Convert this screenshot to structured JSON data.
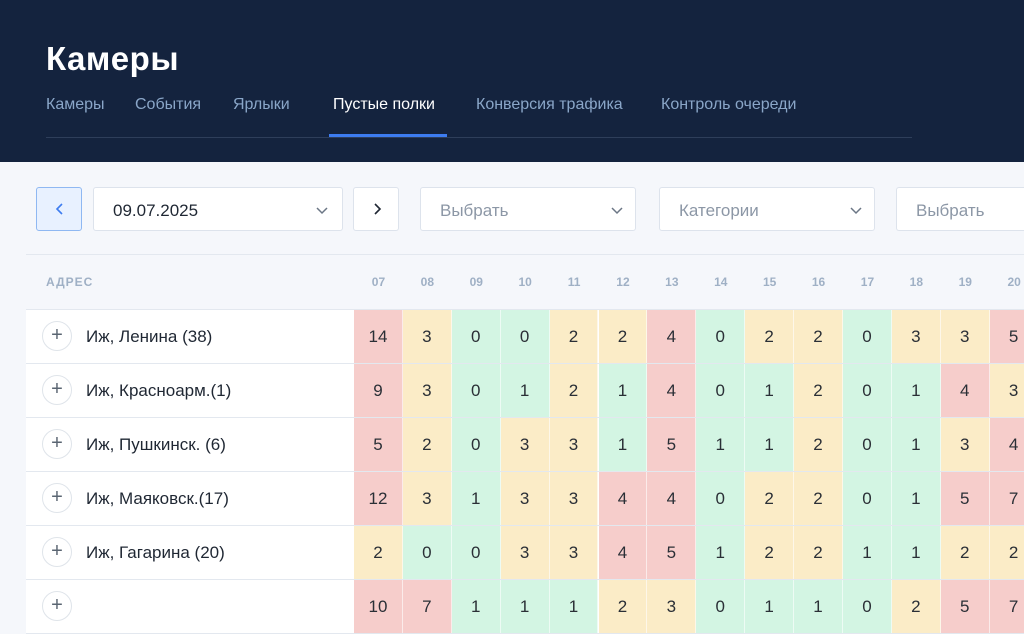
{
  "header": {
    "title": "Камеры",
    "tabs": [
      {
        "label": "Камеры",
        "active": false
      },
      {
        "label": "События",
        "active": false
      },
      {
        "label": "Ярлыки",
        "active": false
      },
      {
        "label": "Пустые полки",
        "active": true
      },
      {
        "label": "Конверсия трафика",
        "active": false
      },
      {
        "label": "Контроль очереди",
        "active": false
      }
    ]
  },
  "filters": {
    "date": "09.07.2025",
    "select1_placeholder": "Выбрать",
    "categories_placeholder": "Категории",
    "select2_placeholder": "Выбрать"
  },
  "icons": {
    "prev": "chevron-left-icon",
    "next": "chevron-right-icon",
    "dropdown": "chevron-down-icon",
    "expand": "plus-icon"
  },
  "colors": {
    "header_bg": "#14233e",
    "accent": "#3d7cf0",
    "high": "#f6cdcb",
    "medium": "#fbecc7",
    "low": "#d3f5e3"
  },
  "table": {
    "address_header": "АДРЕС",
    "hours": [
      "07",
      "08",
      "09",
      "10",
      "11",
      "12",
      "13",
      "14",
      "15",
      "16",
      "17",
      "18",
      "19",
      "20"
    ],
    "rows": [
      {
        "address": "Иж, Ленина (38)",
        "values": [
          "14",
          "3",
          "0",
          "0",
          "2",
          "2",
          "4",
          "0",
          "2",
          "2",
          "0",
          "3",
          "3",
          "5"
        ],
        "levels": [
          "r",
          "y",
          "g",
          "g",
          "y",
          "y",
          "r",
          "g",
          "y",
          "y",
          "g",
          "y",
          "y",
          "r"
        ]
      },
      {
        "address": "Иж, Красноарм.(1)",
        "values": [
          "9",
          "3",
          "0",
          "1",
          "2",
          "1",
          "4",
          "0",
          "1",
          "2",
          "0",
          "1",
          "4",
          "3"
        ],
        "levels": [
          "r",
          "y",
          "g",
          "g",
          "y",
          "g",
          "r",
          "g",
          "g",
          "y",
          "g",
          "g",
          "r",
          "y"
        ]
      },
      {
        "address": "Иж, Пушкинск. (6)",
        "values": [
          "5",
          "2",
          "0",
          "3",
          "3",
          "1",
          "5",
          "1",
          "1",
          "2",
          "0",
          "1",
          "3",
          "4"
        ],
        "levels": [
          "r",
          "y",
          "g",
          "y",
          "y",
          "g",
          "r",
          "g",
          "g",
          "y",
          "g",
          "g",
          "y",
          "r"
        ]
      },
      {
        "address": "Иж, Маяковск.(17)",
        "values": [
          "12",
          "3",
          "1",
          "3",
          "3",
          "4",
          "4",
          "0",
          "2",
          "2",
          "0",
          "1",
          "5",
          "7"
        ],
        "levels": [
          "r",
          "y",
          "g",
          "y",
          "y",
          "r",
          "r",
          "g",
          "y",
          "y",
          "g",
          "g",
          "r",
          "r"
        ]
      },
      {
        "address": "Иж, Гагарина (20)",
        "values": [
          "2",
          "0",
          "0",
          "3",
          "3",
          "4",
          "5",
          "1",
          "2",
          "2",
          "1",
          "1",
          "2",
          "2"
        ],
        "levels": [
          "y",
          "g",
          "g",
          "y",
          "y",
          "r",
          "r",
          "g",
          "y",
          "y",
          "g",
          "g",
          "y",
          "y"
        ]
      },
      {
        "address": "",
        "values": [
          "10",
          "7",
          "1",
          "1",
          "1",
          "2",
          "3",
          "0",
          "1",
          "1",
          "0",
          "2",
          "5",
          "7"
        ],
        "levels": [
          "r",
          "r",
          "g",
          "g",
          "g",
          "y",
          "y",
          "g",
          "g",
          "g",
          "g",
          "y",
          "r",
          "r"
        ]
      }
    ]
  }
}
